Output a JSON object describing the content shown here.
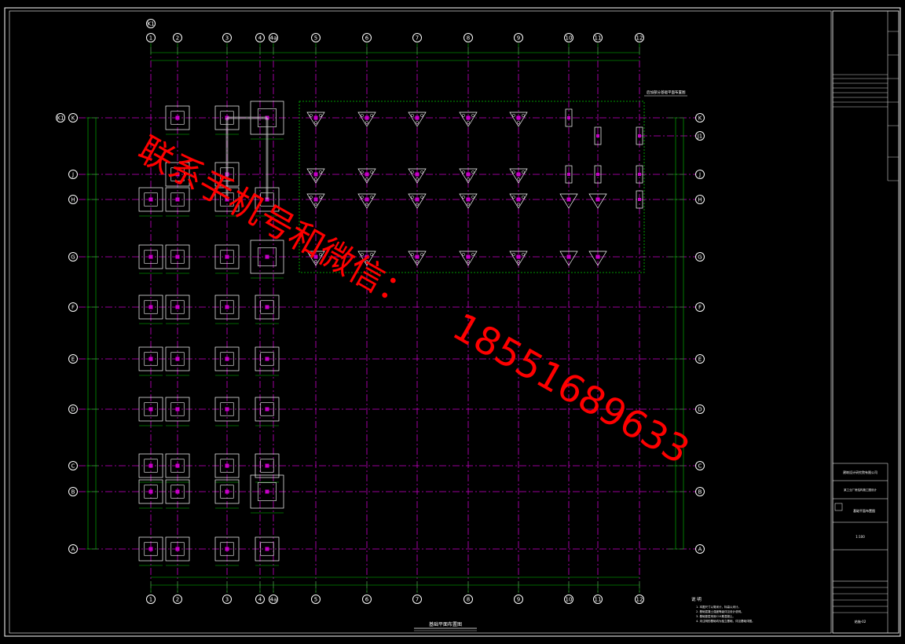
{
  "drawing": {
    "col_axes": [
      "1",
      "2",
      "3",
      "4",
      "4a",
      "5",
      "6",
      "7",
      "8",
      "9",
      "10",
      "11",
      "12"
    ],
    "row_axes": [
      "K",
      "J",
      "H",
      "G",
      "F",
      "E",
      "D",
      "C",
      "B",
      "A"
    ],
    "row_axis_extra": "K1",
    "right_extra_axis": "J1",
    "top_extra_axis": "4a",
    "title": "基础平面布置图",
    "notes_heading": "说 明",
    "notes": [
      "1. 本图尺寸以毫米计，标高以米计。",
      "2. 基础混凝土强度等级详见设计说明。",
      "3. 基础垫层采用C15素混凝土。",
      "4. 未注明的基础均为独立基础，详见基础详图。"
    ],
    "box_label": "后加部分基础平面布置图",
    "colors": {
      "background": "#000000",
      "axis_line": "#c800c8",
      "dim_line": "#00c800",
      "footing": "#ffffff",
      "watermark": "#ff0000"
    }
  },
  "title_block": {
    "company": "建筑设计研究院有限公司",
    "project": "某工业厂房结构施工图设计",
    "drawing_name": "基础平面布置图",
    "scale": "1:100",
    "sheet_no": "结施-02"
  },
  "watermark": {
    "line1": "联系手机号和微信：",
    "line2": "18551689633"
  }
}
